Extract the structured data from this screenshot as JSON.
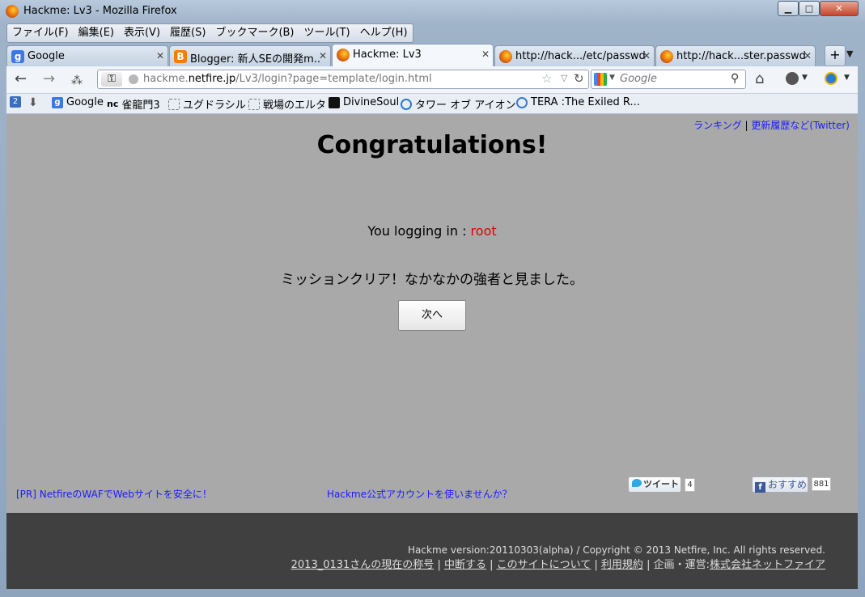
{
  "window": {
    "title": "Hackme: Lv3 - Mozilla Firefox",
    "min_glyph": "▁",
    "max_glyph": "□",
    "close_glyph": "✕"
  },
  "menu": [
    "ファイル(F)",
    "編集(E)",
    "表示(V)",
    "履歴(S)",
    "ブックマーク(B)",
    "ツール(T)",
    "ヘルプ(H)"
  ],
  "tabs": [
    {
      "label": "Google",
      "icon": "google-icon"
    },
    {
      "label": "Blogger: 新人SEの開発m...",
      "icon": "blogger-icon"
    },
    {
      "label": "Hackme: Lv3",
      "icon": "firefox-icon",
      "active": true
    },
    {
      "label": "http://hack.../etc/passwd",
      "icon": "firefox-icon"
    },
    {
      "label": "http://hack...ster.passwd",
      "icon": "firefox-icon"
    }
  ],
  "navbar": {
    "url_prefix": "hackme.",
    "url_domain": "netfire.jp",
    "url_path": "/Lv3/login?page=template/login.html",
    "search_placeholder": "Google"
  },
  "bookmarks": [
    "Google",
    "nc",
    "雀龍門3",
    "ユグドラシル",
    "戦場のエルタ",
    "DivineSoul",
    "タワー オブ アイオン",
    "TERA :The Exiled R..."
  ],
  "page": {
    "top_links": {
      "ranking": "ランキング",
      "sep": "|",
      "updates": "更新履歴など(Twitter)"
    },
    "heading": "Congratulations!",
    "login_prefix": "You logging in : ",
    "login_user": "root",
    "mission_text": "ミッションクリア！なかなかの強者と見ました。",
    "next_button": "次へ",
    "pr_link": "[PR] NetfireのWAFでWebサイトを安全に！",
    "account_link": "Hackme公式アカウントを使いませんか？",
    "tweet_label": "ツイート",
    "tweet_count": "4",
    "fb_label": "おすすめ",
    "fb_count": "881"
  },
  "footer": {
    "copyright": "Hackme version:20110303(alpha) / Copyright © 2013 Netfire, Inc. All rights reserved.",
    "links": [
      "2013_0131さんの現在の称号",
      "中断する",
      "このサイトについて",
      "利用規約"
    ],
    "operator_prefix": "企画・運営:",
    "operator_link": "株式会社ネットファイア"
  },
  "colors": {
    "page_bg": "#a9a9a9",
    "footer_bg": "#404040",
    "link": "#1a1aff",
    "user": "#e00000"
  }
}
